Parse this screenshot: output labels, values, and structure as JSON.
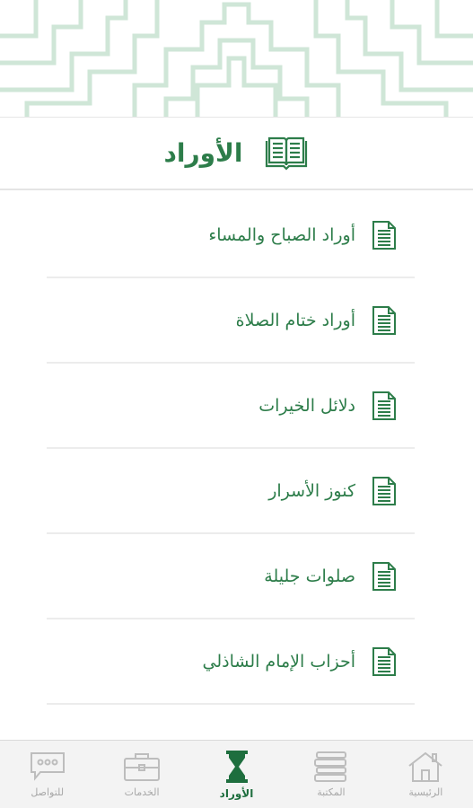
{
  "header": {
    "title": "الأوراد",
    "title_icon": "open-book-icon"
  },
  "list": {
    "items": [
      {
        "label": "أوراد الصباح والمساء",
        "icon": "document-icon"
      },
      {
        "label": "أوراد ختام الصلاة",
        "icon": "document-icon"
      },
      {
        "label": "دلائل الخيرات",
        "icon": "document-icon"
      },
      {
        "label": "كنوز الأسرار",
        "icon": "document-icon"
      },
      {
        "label": "صلوات جليلة",
        "icon": "document-icon"
      },
      {
        "label": "أحزاب الإمام الشاذلي",
        "icon": "document-icon"
      }
    ]
  },
  "tabbar": {
    "tabs": [
      {
        "label": "الرئيسية",
        "icon": "home-icon",
        "active": false
      },
      {
        "label": "المكتبة",
        "icon": "books-icon",
        "active": false
      },
      {
        "label": "الأوراد",
        "icon": "hourglass-icon",
        "active": true
      },
      {
        "label": "الخدمات",
        "icon": "briefcase-icon",
        "active": false
      },
      {
        "label": "للتواصل",
        "icon": "chat-icon",
        "active": false
      }
    ]
  },
  "colors": {
    "accent": "#2d7d4a",
    "pattern": "#cfe6d7",
    "inactive": "#a8a8a8"
  }
}
